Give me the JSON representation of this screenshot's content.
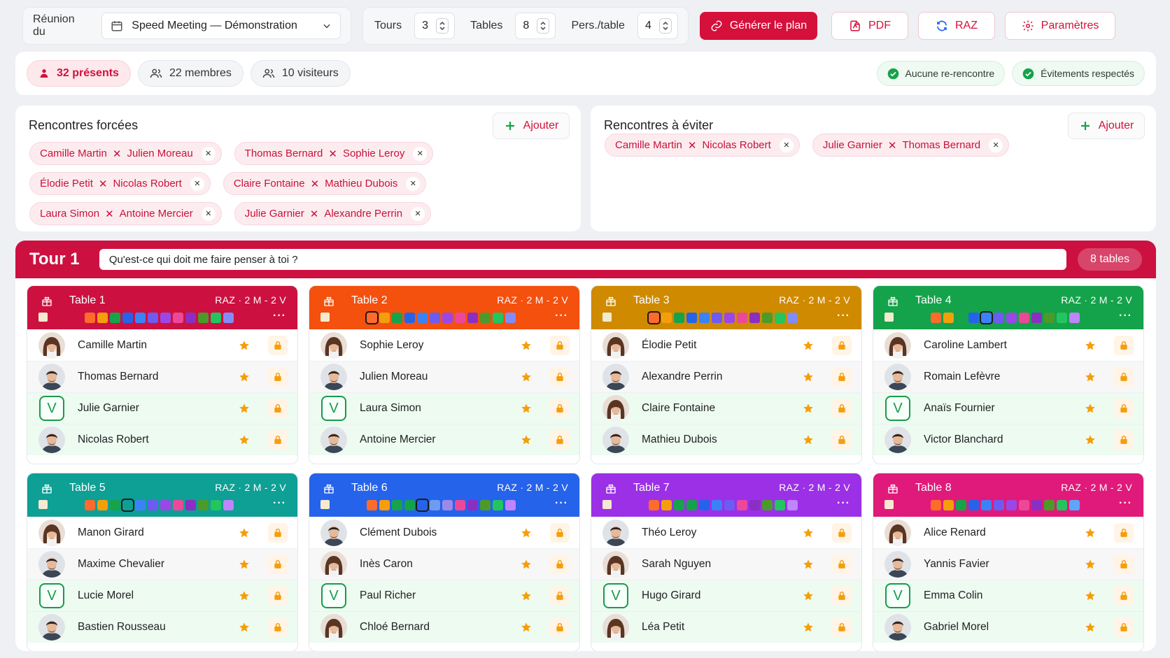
{
  "toolbar": {
    "meeting_label": "Réunion du",
    "meeting_value": "Speed Meeting — Démonstration",
    "tours_label": "Tours",
    "tours_value": "3",
    "tables_label": "Tables",
    "tables_value": "8",
    "pers_label": "Pers./table",
    "pers_value": "4",
    "generate_label": "Générer le plan",
    "pdf_label": "PDF",
    "raz_label": "RAZ",
    "settings_label": "Paramètres"
  },
  "summary": {
    "present": "32 présents",
    "members": "22 membres",
    "visitors": "10 visiteurs",
    "no_repeat": "Aucune re-rencontre",
    "avoid_ok": "Évitements respectés"
  },
  "forced": {
    "title": "Rencontres forcées",
    "add_label": "Ajouter",
    "pairs": [
      [
        "Camille Martin",
        "Julien Moreau"
      ],
      [
        "Thomas Bernard",
        "Sophie Leroy"
      ],
      [
        "Élodie Petit",
        "Nicolas Robert"
      ],
      [
        "Claire Fontaine",
        "Mathieu Dubois"
      ],
      [
        "Laura Simon",
        "Antoine Mercier"
      ],
      [
        "Julie Garnier",
        "Alexandre Perrin"
      ]
    ]
  },
  "avoid": {
    "title": "Rencontres à éviter",
    "add_label": "Ajouter",
    "pairs": [
      [
        "Camille Martin",
        "Nicolas Robert"
      ],
      [
        "Julie Garnier",
        "Thomas Bernard"
      ]
    ]
  },
  "tour": {
    "title": "Tour 1",
    "question": "Qu'est-ce qui doit me faire penser à toi ?",
    "count": "8 tables"
  },
  "colors": {
    "accent": "#d5103b",
    "palette": [
      "#f97316",
      "#f59e0b",
      "#16a34a",
      "#2563eb",
      "#3b82f6",
      "#8b5cf6",
      "#7c3aed",
      "#ec4899",
      "#b91c1c",
      "#4d7c0f",
      "#22c55e",
      "#6366f1"
    ]
  },
  "tables": [
    {
      "name": "Table 1",
      "info": "RAZ · 2 M - 2 V",
      "color": "#cc1140",
      "selected": -1,
      "swatches": [
        "#ff6b2b",
        "#f59e0b",
        "#16a34a",
        "#2563eb",
        "#3b82f6",
        "#6d5bf2",
        "#9b47e8",
        "#ec4899",
        "#8b2ec4",
        "#4c9a2a",
        "#22c55e",
        "#818cf8"
      ],
      "people": [
        {
          "name": "Camille Martin",
          "type": "M",
          "g": "f"
        },
        {
          "name": "Thomas Bernard",
          "type": "M",
          "g": "m"
        },
        {
          "name": "Julie Garnier",
          "type": "V"
        },
        {
          "name": "Nicolas Robert",
          "type": "M",
          "g": "m"
        }
      ]
    },
    {
      "name": "Table 2",
      "info": "RAZ · 2 M - 2 V",
      "color": "#f4500e",
      "selected": 0,
      "swatches": [
        "#ff6b2b",
        "#f59e0b",
        "#16a34a",
        "#2563eb",
        "#3b82f6",
        "#6d5bf2",
        "#9b47e8",
        "#ec4899",
        "#8b2ec4",
        "#4c9a2a",
        "#22c55e",
        "#818cf8"
      ],
      "people": [
        {
          "name": "Sophie Leroy",
          "type": "M",
          "g": "f"
        },
        {
          "name": "Julien Moreau",
          "type": "M",
          "g": "m"
        },
        {
          "name": "Laura Simon",
          "type": "V"
        },
        {
          "name": "Antoine Mercier",
          "type": "M",
          "g": "m"
        }
      ]
    },
    {
      "name": "Table 3",
      "info": "RAZ · 2 M - 2 V",
      "color": "#cf8a00",
      "selected": 0,
      "swatches": [
        "#ff6b2b",
        "#f59e0b",
        "#16a34a",
        "#2563eb",
        "#3b82f6",
        "#6d5bf2",
        "#9b47e8",
        "#ec4899",
        "#8b2ec4",
        "#4c9a2a",
        "#22c55e",
        "#818cf8"
      ],
      "people": [
        {
          "name": "Élodie Petit",
          "type": "M",
          "g": "f"
        },
        {
          "name": "Alexandre Perrin",
          "type": "M",
          "g": "m"
        },
        {
          "name": "Claire Fontaine",
          "type": "M",
          "g": "f"
        },
        {
          "name": "Mathieu Dubois",
          "type": "M",
          "g": "m"
        }
      ]
    },
    {
      "name": "Table 4",
      "info": "RAZ · 2 M - 2 V",
      "color": "#14a34a",
      "selected": 4,
      "swatches": [
        "#ff6b2b",
        "#f59e0b",
        "#16a34a",
        "#2563eb",
        "#3b82f6",
        "#6d5bf2",
        "#9b47e8",
        "#ec4899",
        "#8b2ec4",
        "#4c9a2a",
        "#22c55e",
        "#c084fc"
      ],
      "people": [
        {
          "name": "Caroline Lambert",
          "type": "M",
          "g": "f"
        },
        {
          "name": "Romain Lefèvre",
          "type": "M",
          "g": "m"
        },
        {
          "name": "Anaïs Fournier",
          "type": "V"
        },
        {
          "name": "Victor Blanchard",
          "type": "M",
          "g": "m"
        }
      ]
    },
    {
      "name": "Table 5",
      "info": "RAZ · 2 M - 2 V",
      "color": "#0e9f95",
      "selected": 3,
      "swatches": [
        "#ff6b2b",
        "#f59e0b",
        "#16a34a",
        "#0e9f95",
        "#3b82f6",
        "#6d5bf2",
        "#9b47e8",
        "#ec4899",
        "#8b2ec4",
        "#4c9a2a",
        "#22c55e",
        "#c084fc"
      ],
      "people": [
        {
          "name": "Manon Girard",
          "type": "M",
          "g": "f"
        },
        {
          "name": "Maxime Chevalier",
          "type": "M",
          "g": "m"
        },
        {
          "name": "Lucie Morel",
          "type": "V"
        },
        {
          "name": "Bastien Rousseau",
          "type": "M",
          "g": "m"
        }
      ]
    },
    {
      "name": "Table 6",
      "info": "RAZ · 2 M - 2 V",
      "color": "#2563eb",
      "selected": 4,
      "swatches": [
        "#ff6b2b",
        "#f59e0b",
        "#16a34a",
        "#14a34a",
        "#2563eb",
        "#6d9cf2",
        "#9b8ae8",
        "#ec4899",
        "#8b2ec4",
        "#4c9a2a",
        "#22c55e",
        "#c084fc"
      ],
      "people": [
        {
          "name": "Clément Dubois",
          "type": "M",
          "g": "m"
        },
        {
          "name": "Inès Caron",
          "type": "M",
          "g": "f"
        },
        {
          "name": "Paul Richer",
          "type": "V"
        },
        {
          "name": "Chloé Bernard",
          "type": "M",
          "g": "f"
        }
      ]
    },
    {
      "name": "Table 7",
      "info": "RAZ · 2 M - 2 V",
      "color": "#9b30e6",
      "selected": -1,
      "swatches": [
        "#ff6b2b",
        "#f59e0b",
        "#16a34a",
        "#14a34a",
        "#2563eb",
        "#3b82f6",
        "#6d5bf2",
        "#ec4899",
        "#8b2ec4",
        "#4c9a2a",
        "#22c55e",
        "#c084fc"
      ],
      "people": [
        {
          "name": "Théo Leroy",
          "type": "M",
          "g": "m"
        },
        {
          "name": "Sarah Nguyen",
          "type": "M",
          "g": "f"
        },
        {
          "name": "Hugo Girard",
          "type": "V"
        },
        {
          "name": "Léa Petit",
          "type": "M",
          "g": "f"
        }
      ]
    },
    {
      "name": "Table 8",
      "info": "RAZ · 2 M - 2 V",
      "color": "#e01a7a",
      "selected": -1,
      "swatches": [
        "#ff6b2b",
        "#f59e0b",
        "#16a34a",
        "#2563eb",
        "#3b82f6",
        "#6d5bf2",
        "#9b47e8",
        "#ec4899",
        "#8b2ec4",
        "#4c9a2a",
        "#22c55e",
        "#60a5fa"
      ],
      "people": [
        {
          "name": "Alice Renard",
          "type": "M",
          "g": "f"
        },
        {
          "name": "Yannis Favier",
          "type": "M",
          "g": "m"
        },
        {
          "name": "Emma Colin",
          "type": "V"
        },
        {
          "name": "Gabriel Morel",
          "type": "M",
          "g": "m"
        }
      ]
    }
  ]
}
